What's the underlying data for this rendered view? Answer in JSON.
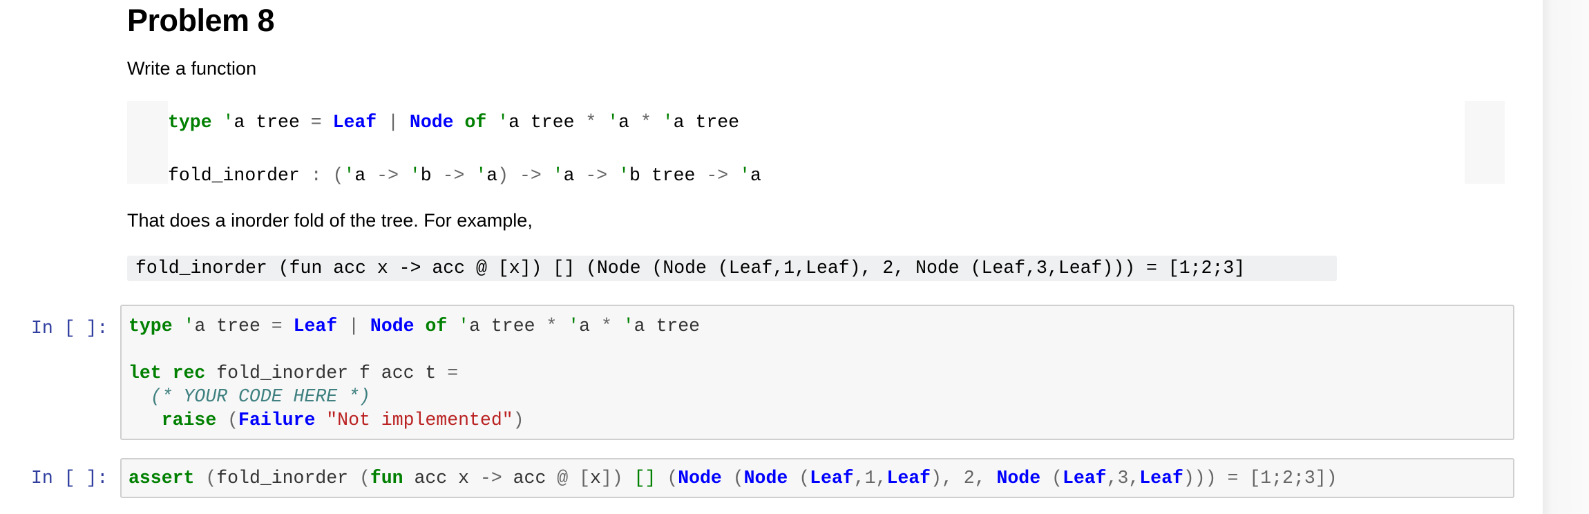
{
  "markdown": {
    "title": "Problem 8",
    "intro": "Write a function",
    "type_block": {
      "line1": [
        {
          "t": "type",
          "c": "kw"
        },
        {
          "t": " ",
          "c": ""
        },
        {
          "t": "'",
          "c": "tv"
        },
        {
          "t": "a tree ",
          "c": ""
        },
        {
          "t": "=",
          "c": "op"
        },
        {
          "t": " ",
          "c": ""
        },
        {
          "t": "Leaf",
          "c": "ctor"
        },
        {
          "t": " ",
          "c": ""
        },
        {
          "t": "|",
          "c": "bar"
        },
        {
          "t": " ",
          "c": ""
        },
        {
          "t": "Node",
          "c": "ctor"
        },
        {
          "t": " ",
          "c": ""
        },
        {
          "t": "of",
          "c": "kw"
        },
        {
          "t": " ",
          "c": ""
        },
        {
          "t": "'",
          "c": "tv"
        },
        {
          "t": "a tree ",
          "c": ""
        },
        {
          "t": "*",
          "c": "op"
        },
        {
          "t": " ",
          "c": ""
        },
        {
          "t": "'",
          "c": "tv"
        },
        {
          "t": "a ",
          "c": ""
        },
        {
          "t": "*",
          "c": "op"
        },
        {
          "t": " ",
          "c": ""
        },
        {
          "t": "'",
          "c": "tv"
        },
        {
          "t": "a tree",
          "c": ""
        }
      ],
      "line2": [
        {
          "t": "fold_inorder ",
          "c": ""
        },
        {
          "t": ":",
          "c": "op"
        },
        {
          "t": " ",
          "c": ""
        },
        {
          "t": "(",
          "c": "op"
        },
        {
          "t": "'",
          "c": "tv"
        },
        {
          "t": "a ",
          "c": ""
        },
        {
          "t": "->",
          "c": "op"
        },
        {
          "t": " ",
          "c": ""
        },
        {
          "t": "'",
          "c": "tv"
        },
        {
          "t": "b ",
          "c": ""
        },
        {
          "t": "->",
          "c": "op"
        },
        {
          "t": " ",
          "c": ""
        },
        {
          "t": "'",
          "c": "tv"
        },
        {
          "t": "a",
          "c": ""
        },
        {
          "t": ")",
          "c": "op"
        },
        {
          "t": " ",
          "c": ""
        },
        {
          "t": "->",
          "c": "op"
        },
        {
          "t": " ",
          "c": ""
        },
        {
          "t": "'",
          "c": "tv"
        },
        {
          "t": "a ",
          "c": ""
        },
        {
          "t": "->",
          "c": "op"
        },
        {
          "t": " ",
          "c": ""
        },
        {
          "t": "'",
          "c": "tv"
        },
        {
          "t": "b tree ",
          "c": ""
        },
        {
          "t": "->",
          "c": "op"
        },
        {
          "t": " ",
          "c": ""
        },
        {
          "t": "'",
          "c": "tv"
        },
        {
          "t": "a",
          "c": ""
        }
      ]
    },
    "description": "That does a inorder fold of the tree. For example,",
    "example": "fold_inorder (fun acc x -> acc @ [x]) [] (Node (Node (Leaf,1,Leaf), 2, Node (Leaf,3,Leaf))) = [1;2;3]"
  },
  "cells": [
    {
      "prompt": "In [ ]:",
      "lines": [
        [
          {
            "t": "type",
            "c": "kw"
          },
          {
            "t": " ",
            "c": ""
          },
          {
            "t": "'",
            "c": "tv"
          },
          {
            "t": "a tree ",
            "c": ""
          },
          {
            "t": "=",
            "c": "op"
          },
          {
            "t": " ",
            "c": ""
          },
          {
            "t": "Leaf",
            "c": "ctor"
          },
          {
            "t": " ",
            "c": ""
          },
          {
            "t": "|",
            "c": "bar"
          },
          {
            "t": " ",
            "c": ""
          },
          {
            "t": "Node",
            "c": "ctor"
          },
          {
            "t": " ",
            "c": ""
          },
          {
            "t": "of",
            "c": "kw"
          },
          {
            "t": " ",
            "c": ""
          },
          {
            "t": "'",
            "c": "tv"
          },
          {
            "t": "a tree ",
            "c": ""
          },
          {
            "t": "*",
            "c": "op"
          },
          {
            "t": " ",
            "c": ""
          },
          {
            "t": "'",
            "c": "tv"
          },
          {
            "t": "a ",
            "c": ""
          },
          {
            "t": "*",
            "c": "op"
          },
          {
            "t": " ",
            "c": ""
          },
          {
            "t": "'",
            "c": "tv"
          },
          {
            "t": "a tree",
            "c": ""
          }
        ],
        [],
        [
          {
            "t": "let",
            "c": "kw"
          },
          {
            "t": " ",
            "c": ""
          },
          {
            "t": "rec",
            "c": "kw"
          },
          {
            "t": " fold_inorder f acc t ",
            "c": ""
          },
          {
            "t": "=",
            "c": "op"
          }
        ],
        [
          {
            "t": "  ",
            "c": ""
          },
          {
            "t": "(* YOUR CODE HERE *)",
            "c": "cm"
          }
        ],
        [
          {
            "t": "   ",
            "c": ""
          },
          {
            "t": "raise",
            "c": "kw"
          },
          {
            "t": " ",
            "c": ""
          },
          {
            "t": "(",
            "c": "op"
          },
          {
            "t": "Failure",
            "c": "ctor"
          },
          {
            "t": " ",
            "c": ""
          },
          {
            "t": "\"Not implemented\"",
            "c": "str"
          },
          {
            "t": ")",
            "c": "op"
          }
        ]
      ]
    },
    {
      "prompt": "In [ ]:",
      "lines": [
        [
          {
            "t": "assert",
            "c": "kw"
          },
          {
            "t": " ",
            "c": ""
          },
          {
            "t": "(",
            "c": "op"
          },
          {
            "t": "fold_inorder ",
            "c": ""
          },
          {
            "t": "(",
            "c": "op"
          },
          {
            "t": "fun",
            "c": "kw"
          },
          {
            "t": " acc x ",
            "c": ""
          },
          {
            "t": "->",
            "c": "op"
          },
          {
            "t": " acc ",
            "c": ""
          },
          {
            "t": "@",
            "c": "op"
          },
          {
            "t": " ",
            "c": ""
          },
          {
            "t": "[",
            "c": "op"
          },
          {
            "t": "x",
            "c": ""
          },
          {
            "t": "])",
            "c": "op"
          },
          {
            "t": " ",
            "c": ""
          },
          {
            "t": "[]",
            "c": "tv"
          },
          {
            "t": " ",
            "c": ""
          },
          {
            "t": "(",
            "c": "op"
          },
          {
            "t": "Node",
            "c": "ctor"
          },
          {
            "t": " ",
            "c": ""
          },
          {
            "t": "(",
            "c": "op"
          },
          {
            "t": "Node",
            "c": "ctor"
          },
          {
            "t": " ",
            "c": ""
          },
          {
            "t": "(",
            "c": "op"
          },
          {
            "t": "Leaf",
            "c": "ctor"
          },
          {
            "t": ",1,",
            "c": "op"
          },
          {
            "t": "Leaf",
            "c": "ctor"
          },
          {
            "t": "),",
            "c": "op"
          },
          {
            "t": " ",
            "c": ""
          },
          {
            "t": "2,",
            "c": "op"
          },
          {
            "t": " ",
            "c": ""
          },
          {
            "t": "Node",
            "c": "ctor"
          },
          {
            "t": " ",
            "c": ""
          },
          {
            "t": "(",
            "c": "op"
          },
          {
            "t": "Leaf",
            "c": "ctor"
          },
          {
            "t": ",3,",
            "c": "op"
          },
          {
            "t": "Leaf",
            "c": "ctor"
          },
          {
            "t": ")))",
            "c": "op"
          },
          {
            "t": " ",
            "c": ""
          },
          {
            "t": "=",
            "c": "op"
          },
          {
            "t": " ",
            "c": ""
          },
          {
            "t": "[1;2;3])",
            "c": "op"
          }
        ]
      ]
    }
  ]
}
